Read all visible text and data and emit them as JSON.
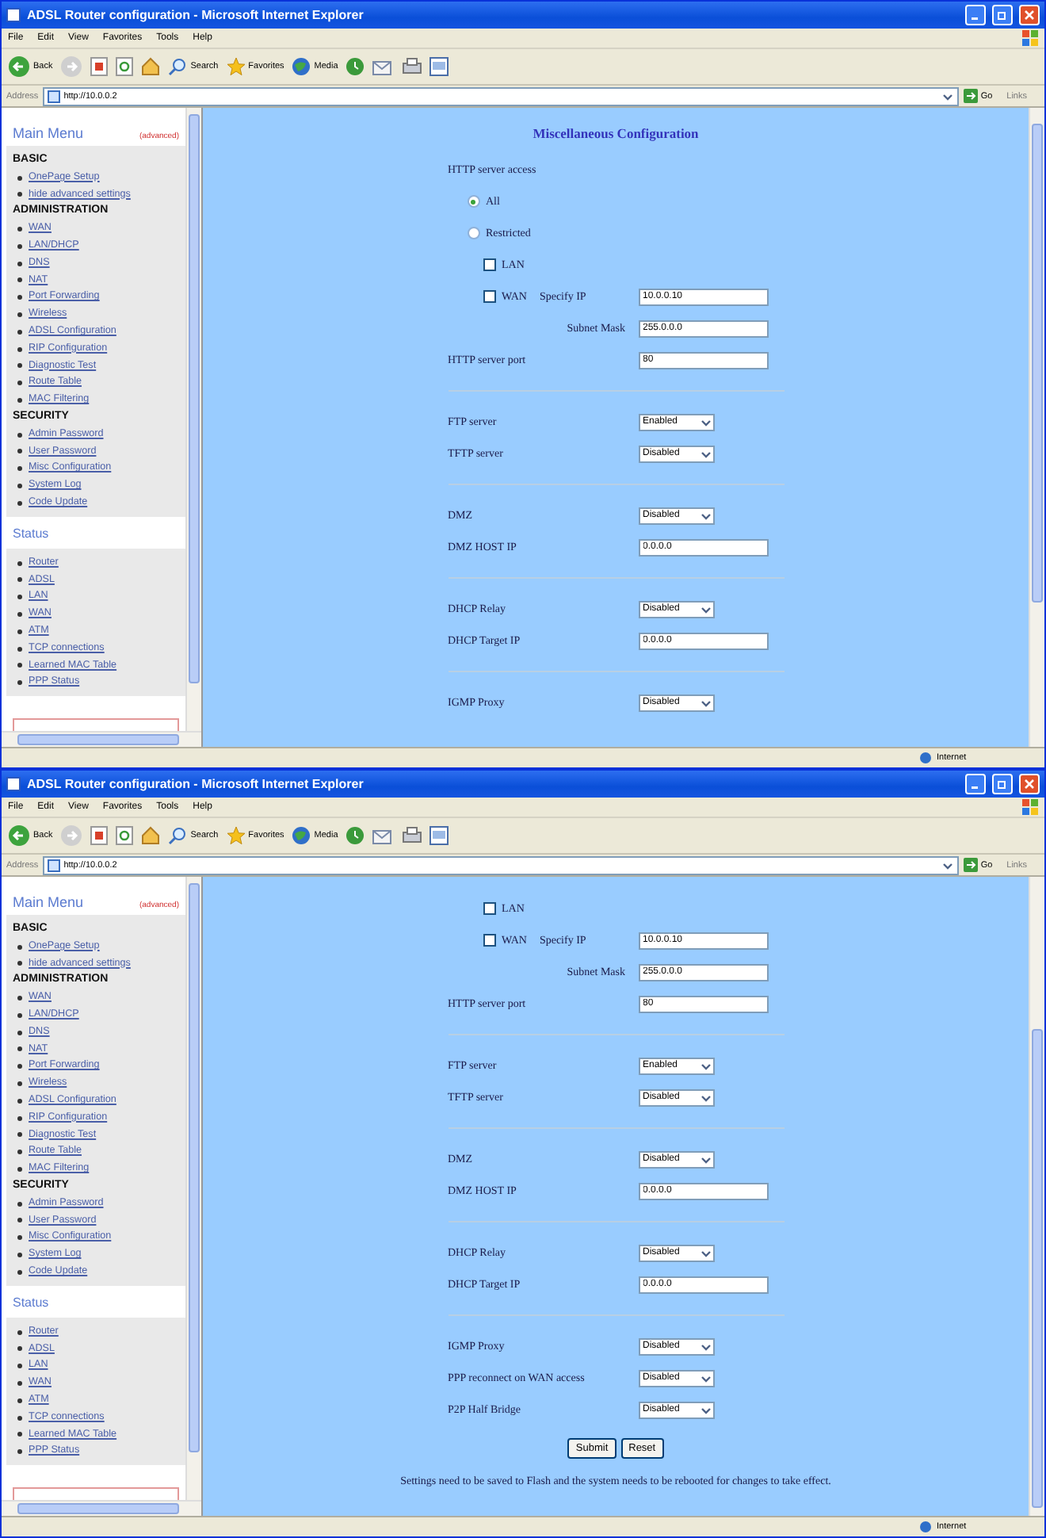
{
  "windows": [
    {
      "title": "ADSL Router configuration - Microsoft Internet Explorer",
      "menu": [
        "File",
        "Edit",
        "View",
        "Favorites",
        "Tools",
        "Help"
      ],
      "toolbar": {
        "back": "Back",
        "search": "Search",
        "favorites": "Favorites",
        "media": "Media"
      },
      "address": {
        "label": "Address",
        "url": "http://10.0.0.2",
        "go": "Go",
        "links": "Links"
      },
      "sidebar": {
        "title": "Main Menu",
        "tag": "(advanced)",
        "sections": [
          {
            "heading": "BASIC",
            "items": [
              "OnePage Setup",
              "hide advanced settings"
            ]
          },
          {
            "heading": "ADMINISTRATION",
            "items": [
              "WAN",
              "LAN/DHCP",
              "DNS",
              "NAT",
              "Port Forwarding",
              "Wireless",
              "ADSL Configuration",
              "RIP Configuration",
              "Diagnostic Test",
              "Route Table",
              "MAC Filtering"
            ]
          },
          {
            "heading": "SECURITY",
            "items": [
              "Admin Password",
              "User Password",
              "Misc Configuration",
              "System Log",
              "Code Update"
            ]
          }
        ],
        "status": {
          "heading": "Status",
          "items": [
            "Router",
            "ADSL",
            "LAN",
            "WAN",
            "ATM",
            "TCP connections",
            "Learned MAC Table",
            "PPP Status"
          ]
        }
      },
      "form": [
        {
          "kind": "title",
          "text": "Miscellaneous Configuration"
        },
        {
          "kind": "label",
          "text": "HTTP server access"
        },
        {
          "kind": "radio",
          "label": "All",
          "selected": true
        },
        {
          "kind": "radio",
          "label": "Restricted",
          "selected": false
        },
        {
          "kind": "checkbox",
          "label": "LAN",
          "checked": false
        },
        {
          "kind": "checkbox",
          "label": "WAN",
          "checked": false,
          "field_label": "Specify IP",
          "value": "10.0.0.10"
        },
        {
          "kind": "subfield",
          "label": "Subnet Mask",
          "value": "255.0.0.0"
        },
        {
          "kind": "field",
          "label": "HTTP server port",
          "value": "80"
        },
        {
          "kind": "divider"
        },
        {
          "kind": "select",
          "label": "FTP server",
          "value": "Enabled"
        },
        {
          "kind": "select",
          "label": "TFTP server",
          "value": "Disabled"
        },
        {
          "kind": "divider"
        },
        {
          "kind": "select",
          "label": "DMZ",
          "value": "Disabled"
        },
        {
          "kind": "field",
          "label": "DMZ HOST IP",
          "value": "0.0.0.0"
        },
        {
          "kind": "divider"
        },
        {
          "kind": "select",
          "label": "DHCP Relay",
          "value": "Disabled"
        },
        {
          "kind": "field",
          "label": "DHCP Target IP",
          "value": "0.0.0.0"
        },
        {
          "kind": "divider"
        },
        {
          "kind": "select",
          "label": "IGMP Proxy",
          "value": "Disabled"
        }
      ],
      "status_bar": "Internet"
    },
    {
      "title": "ADSL Router configuration - Microsoft Internet Explorer",
      "menu": [
        "File",
        "Edit",
        "View",
        "Favorites",
        "Tools",
        "Help"
      ],
      "toolbar": {
        "back": "Back",
        "search": "Search",
        "favorites": "Favorites",
        "media": "Media"
      },
      "address": {
        "label": "Address",
        "url": "http://10.0.0.2",
        "go": "Go",
        "links": "Links"
      },
      "sidebar": {
        "title": "Main Menu",
        "tag": "(advanced)",
        "sections": [
          {
            "heading": "BASIC",
            "items": [
              "OnePage Setup",
              "hide advanced settings"
            ]
          },
          {
            "heading": "ADMINISTRATION",
            "items": [
              "WAN",
              "LAN/DHCP",
              "DNS",
              "NAT",
              "Port Forwarding",
              "Wireless",
              "ADSL Configuration",
              "RIP Configuration",
              "Diagnostic Test",
              "Route Table",
              "MAC Filtering"
            ]
          },
          {
            "heading": "SECURITY",
            "items": [
              "Admin Password",
              "User Password",
              "Misc Configuration",
              "System Log",
              "Code Update"
            ]
          }
        ],
        "status": {
          "heading": "Status",
          "items": [
            "Router",
            "ADSL",
            "LAN",
            "WAN",
            "ATM",
            "TCP connections",
            "Learned MAC Table",
            "PPP Status"
          ]
        }
      },
      "form": [
        {
          "kind": "checkbox",
          "label": "LAN",
          "checked": false
        },
        {
          "kind": "checkbox",
          "label": "WAN",
          "checked": false,
          "field_label": "Specify IP",
          "value": "10.0.0.10"
        },
        {
          "kind": "subfield",
          "label": "Subnet Mask",
          "value": "255.0.0.0"
        },
        {
          "kind": "field",
          "label": "HTTP server port",
          "value": "80"
        },
        {
          "kind": "divider"
        },
        {
          "kind": "select",
          "label": "FTP server",
          "value": "Enabled"
        },
        {
          "kind": "select",
          "label": "TFTP server",
          "value": "Disabled"
        },
        {
          "kind": "divider"
        },
        {
          "kind": "select",
          "label": "DMZ",
          "value": "Disabled"
        },
        {
          "kind": "field",
          "label": "DMZ HOST IP",
          "value": "0.0.0.0"
        },
        {
          "kind": "divider"
        },
        {
          "kind": "select",
          "label": "DHCP Relay",
          "value": "Disabled"
        },
        {
          "kind": "field",
          "label": "DHCP Target IP",
          "value": "0.0.0.0"
        },
        {
          "kind": "divider"
        },
        {
          "kind": "select",
          "label": "IGMP Proxy",
          "value": "Disabled"
        },
        {
          "kind": "select",
          "label": "PPP reconnect on WAN access",
          "value": "Disabled"
        },
        {
          "kind": "select",
          "label": "P2P Half Bridge",
          "value": "Disabled"
        },
        {
          "kind": "buttons",
          "buttons": [
            "Submit",
            "Reset"
          ]
        },
        {
          "kind": "note",
          "text": "Settings need to be saved to Flash and the system needs to be rebooted for changes to take effect."
        }
      ],
      "status_bar": "Internet"
    }
  ]
}
